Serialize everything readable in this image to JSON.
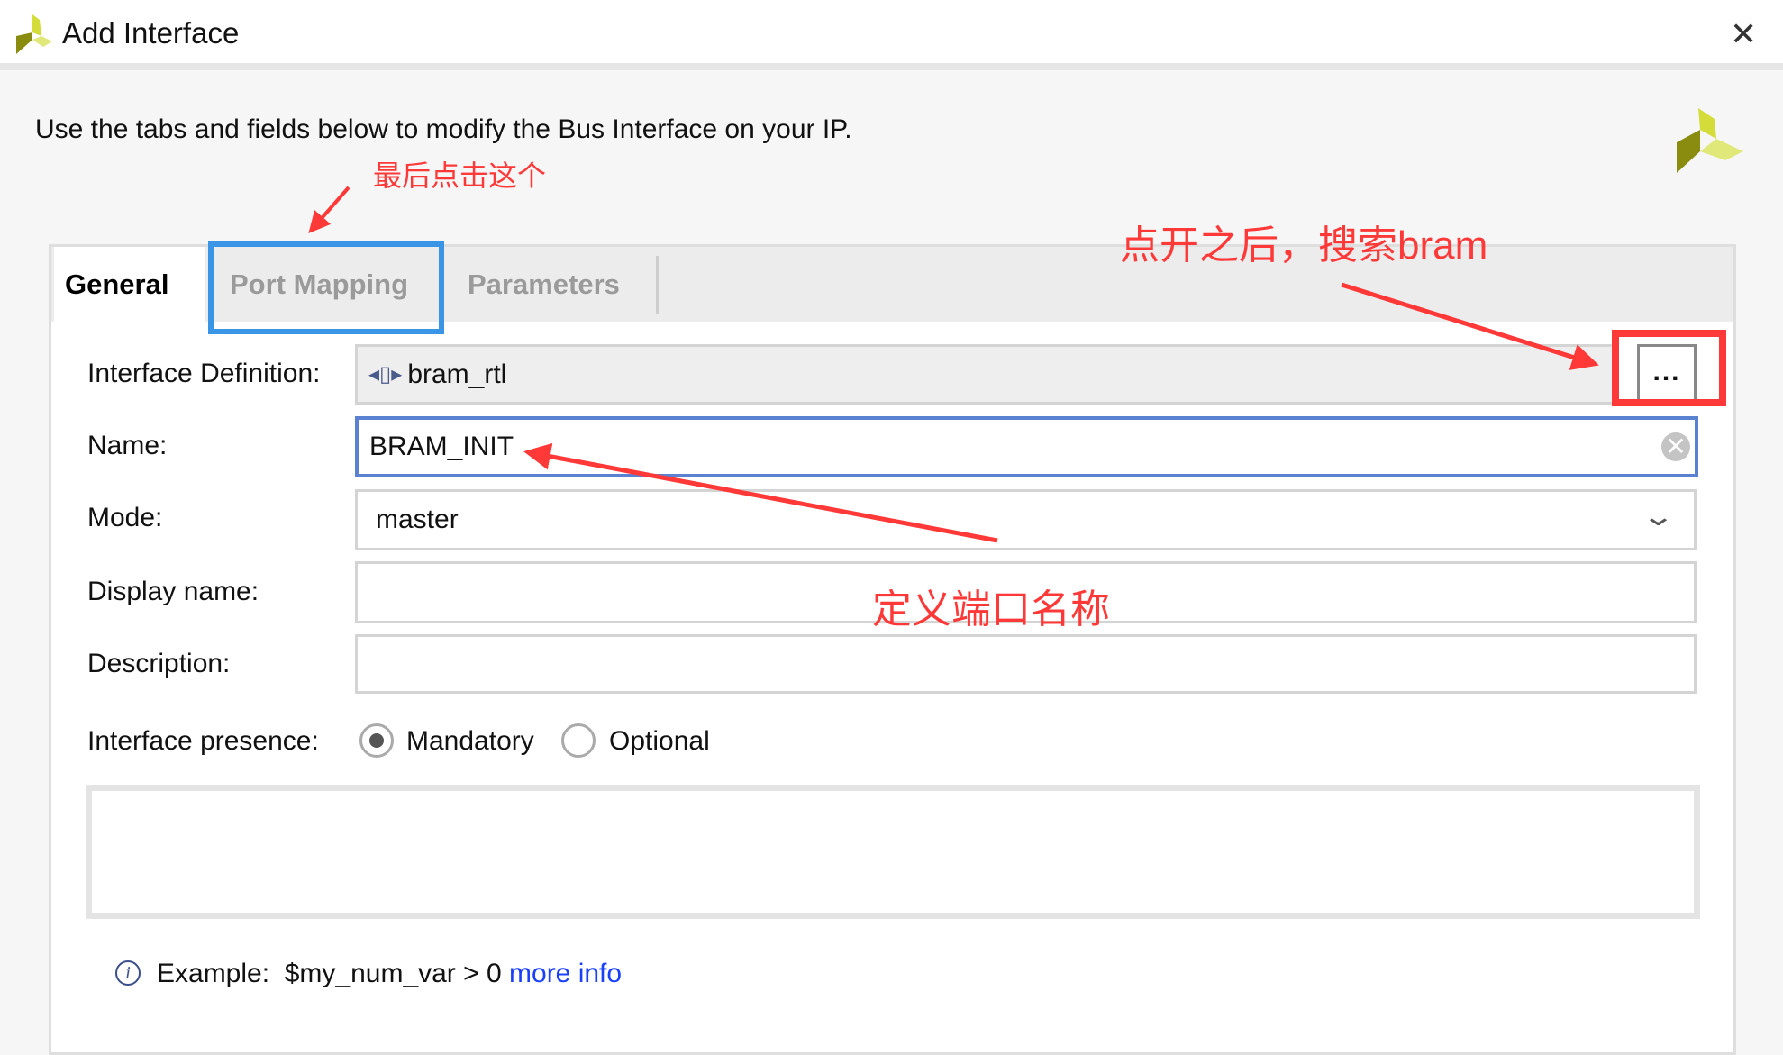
{
  "window": {
    "title": "Add Interface",
    "close_icon": "close-icon"
  },
  "description": "Use the tabs and fields below to modify the Bus Interface on your IP.",
  "tabs": [
    {
      "label": "General",
      "selected": true
    },
    {
      "label": "Port Mapping",
      "selected": false
    },
    {
      "label": "Parameters",
      "selected": false
    }
  ],
  "form": {
    "interface_definition": {
      "label": "Interface Definition:",
      "value": "bram_rtl",
      "browse_label": "..."
    },
    "name": {
      "label": "Name:",
      "value": "BRAM_INIT"
    },
    "mode": {
      "label": "Mode:",
      "value": "master"
    },
    "display_name": {
      "label": "Display name:",
      "value": ""
    },
    "description": {
      "label": "Description:",
      "value": ""
    },
    "presence": {
      "label": "Interface presence:",
      "options": [
        "Mandatory",
        "Optional"
      ],
      "selected": "Mandatory"
    }
  },
  "example": {
    "text": "Example:  $my_num_var > 0 ",
    "link": "more info"
  },
  "annotations": {
    "click_last": "最后点击这个",
    "search_bram": "点开之后，搜索bram",
    "define_name": "定义端口名称"
  },
  "colors": {
    "annotation": "#ff3838",
    "highlight_blue": "#3b95e6",
    "focus_border": "#5a82d0",
    "link": "#1a40ff"
  }
}
